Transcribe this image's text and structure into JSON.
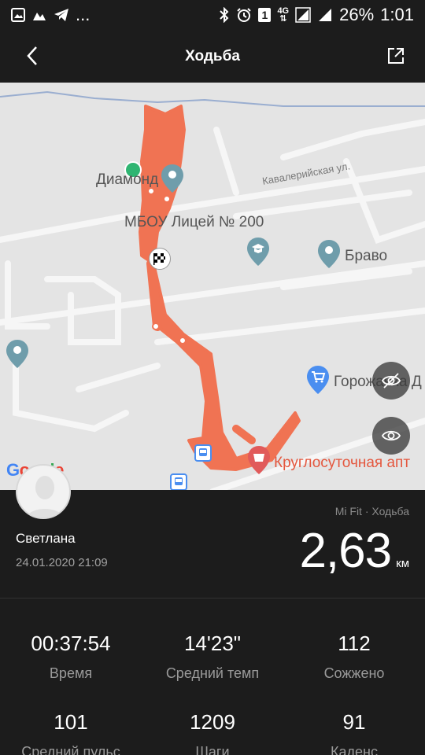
{
  "statusbar": {
    "left_icons": [
      "photo-icon",
      "image-icon",
      "telegram-icon",
      "more-dots-icon"
    ],
    "more": "...",
    "right_icons": [
      "bluetooth-icon",
      "alarm-icon",
      "sim-icon",
      "signal-icon",
      "signal-icon"
    ],
    "sim_number": "1",
    "network": "4G",
    "battery": "26%",
    "time": "1:01"
  },
  "header": {
    "title": "Ходьба"
  },
  "map": {
    "labels": {
      "diamond": "Диамонд",
      "street": "Кавалерийская ул.",
      "school": "МБОУ Лицей № 200",
      "bravo": "Браво",
      "gorozhanka": "Горожанка Д",
      "pharmacy": "Круглосуточная апт",
      "google": "Google"
    },
    "route_color": "#f07353"
  },
  "info": {
    "user_name": "Светлана",
    "date": "24.01.2020 21:09",
    "source": "Mi Fit · Ходьба",
    "distance": "2,63",
    "unit": "км"
  },
  "stats": [
    {
      "value": "00:37:54",
      "label": "Время"
    },
    {
      "value": "14'23\"",
      "label": "Средний темп"
    },
    {
      "value": "112",
      "label": "Сожжено"
    },
    {
      "value": "101",
      "label": "Средний пульс"
    },
    {
      "value": "1209",
      "label": "Шаги"
    },
    {
      "value": "91",
      "label": "Каденс"
    }
  ]
}
